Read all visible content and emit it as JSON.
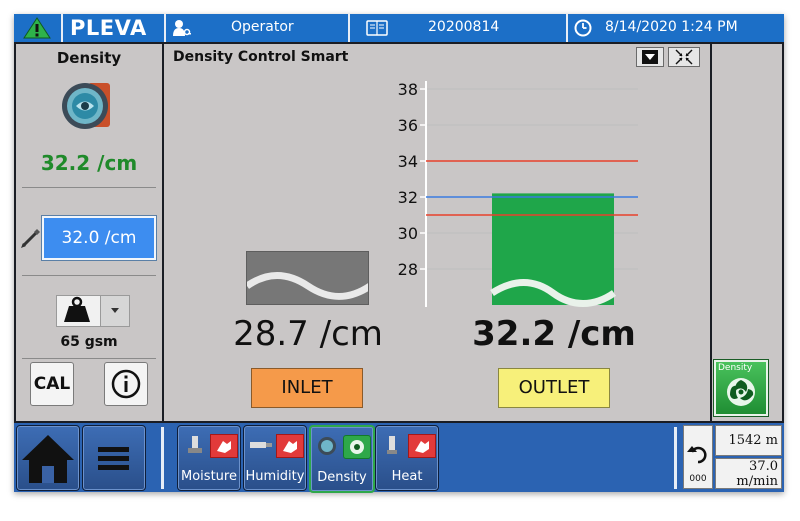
{
  "header": {
    "brand": "PLEVA",
    "user": "Operator",
    "batch": "20200814",
    "datetime": "8/14/2020 1:24 PM",
    "icons": [
      "warning-icon",
      "user-key-icon",
      "batch-book-icon",
      "clock-icon"
    ]
  },
  "left": {
    "title": "Density",
    "measured": "32.2 /cm",
    "setpoint": "32.0 /cm",
    "weight_label": "65 gsm",
    "cal_label": "CAL"
  },
  "main": {
    "title": "Density Control Smart",
    "inlet_value": "28.7 /cm",
    "outlet_value": "32.2 /cm",
    "inlet_label": "INLET",
    "outlet_label": "OUTLET"
  },
  "right": {
    "density_button_label": "Density"
  },
  "bottom": {
    "tabs": [
      {
        "label": "Moisture",
        "active": false
      },
      {
        "label": "Humidity",
        "active": false
      },
      {
        "label": "Density",
        "active": true
      },
      {
        "label": "Heat",
        "active": false
      }
    ],
    "counter": "000",
    "length": "1542 m",
    "speed_value": "37.0",
    "speed_unit": "m/min"
  },
  "chart_data": {
    "type": "bar",
    "categories": [
      "OUTLET"
    ],
    "values": [
      32.2
    ],
    "ylim": [
      26,
      38
    ],
    "yticks": [
      28,
      30,
      32,
      34,
      36,
      38
    ],
    "tick_labels": [
      "28",
      "30",
      "32",
      "34",
      "36",
      "38"
    ],
    "reference_lines": [
      {
        "value": 34,
        "color": "#e8412c"
      },
      {
        "value": 32,
        "color": "#3a7be0"
      },
      {
        "value": 31,
        "color": "#e8412c"
      }
    ],
    "grid": true,
    "bar_color": "#1fa64a",
    "colors": {
      "inlet_button": "#f59a4a",
      "outlet_button": "#f7f07a",
      "accent_blue": "#1c6fc7",
      "measured_green": "#1f8a2a",
      "setpoint_box": "#3d8df0"
    }
  }
}
